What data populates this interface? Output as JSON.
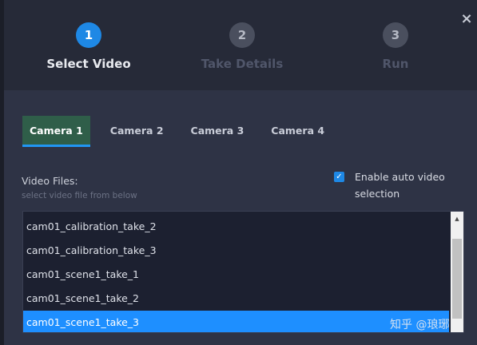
{
  "steps": [
    {
      "number": "1",
      "label": "Select Video"
    },
    {
      "number": "2",
      "label": "Take Details"
    },
    {
      "number": "3",
      "label": "Run"
    }
  ],
  "close_glyph": "×",
  "tabs": [
    {
      "label": "Camera 1"
    },
    {
      "label": "Camera 2"
    },
    {
      "label": "Camera 3"
    },
    {
      "label": "Camera 4"
    }
  ],
  "video_files": {
    "label": "Video Files:",
    "hint": "select video file from below",
    "items": [
      "cam01_calibration_take_2",
      "cam01_calibration_take_3",
      "cam01_scene1_take_1",
      "cam01_scene1_take_2",
      "cam01_scene1_take_3"
    ],
    "selected_index": 4
  },
  "auto_select": {
    "checked": true,
    "label": "Enable auto video selection"
  },
  "watermark": "知乎 @琅琊",
  "colors": {
    "accent": "#1e88e5",
    "active_tab": "#2f5e49",
    "selected_row": "#1e8fff",
    "panel": "#2e3345",
    "header": "#262a38"
  }
}
